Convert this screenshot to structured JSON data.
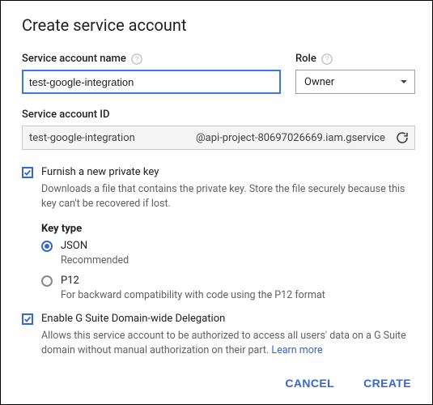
{
  "title": "Create service account",
  "name_field": {
    "label": "Service account name",
    "value": "test-google-integration"
  },
  "role_field": {
    "label": "Role",
    "selected": "Owner"
  },
  "id_field": {
    "label": "Service account ID",
    "prefix": "test-google-integration",
    "suffix": "@api-project-80697026669.iam.gservice"
  },
  "furnish": {
    "label": "Furnish a new private key",
    "desc": "Downloads a file that contains the private key. Store the file securely because this key can't be recovered if lost."
  },
  "key_type": {
    "title": "Key type",
    "json": {
      "label": "JSON",
      "sub": "Recommended"
    },
    "p12": {
      "label": "P12",
      "sub": "For backward compatibility with code using the P12 format"
    }
  },
  "delegation": {
    "label": "Enable G Suite Domain-wide Delegation",
    "desc": "Allows this service account to be authorized to access all users' data on a G Suite domain without manual authorization on their part. ",
    "learn_more": "Learn more"
  },
  "actions": {
    "cancel": "CANCEL",
    "create": "CREATE"
  }
}
